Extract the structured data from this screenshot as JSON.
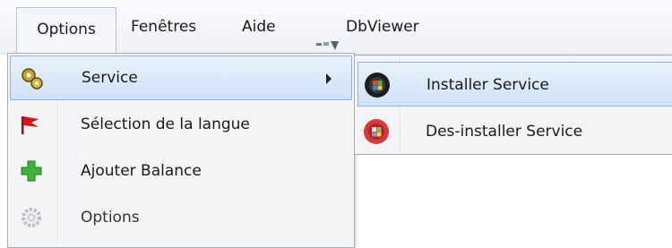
{
  "menubar": {
    "items": [
      "Options",
      "Fenêtres",
      "Aide",
      "DbViewer"
    ]
  },
  "menu": {
    "items": [
      {
        "label": "Service",
        "icon": "gears-icon",
        "highlighted": true,
        "has_submenu": true
      },
      {
        "label": "Sélection de la langue",
        "icon": "red-flag-icon"
      },
      {
        "label": "Ajouter Balance",
        "icon": "green-plus-icon"
      },
      {
        "label": "Options",
        "icon": "gear-icon",
        "disabled_look": true
      }
    ]
  },
  "submenu": {
    "items": [
      {
        "label": "Installer Service",
        "icon": "install-service-icon",
        "highlighted": true
      },
      {
        "label": "Des-installer Service",
        "icon": "uninstall-service-icon"
      }
    ]
  },
  "colors": {
    "highlight_border": "#8db2e3",
    "highlight_fill": "#cfe3f8",
    "menu_bg": "#f3f4f6"
  }
}
